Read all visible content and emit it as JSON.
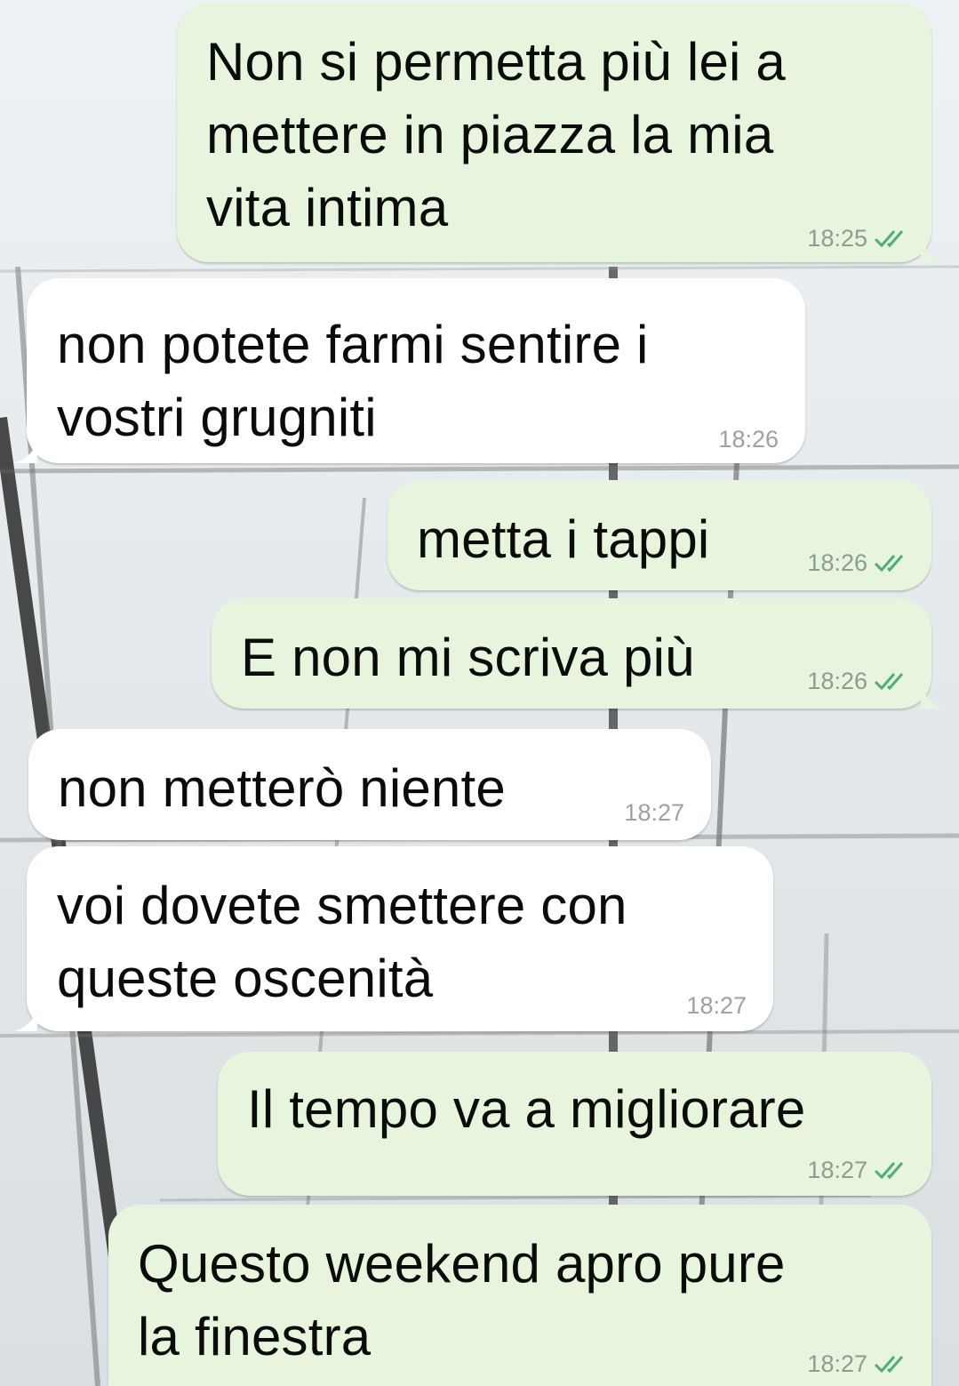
{
  "colors": {
    "outgoing_bubble": "#e6f5dc",
    "incoming_bubble": "#ffffff",
    "timestamp": "#8d9c95",
    "read_ticks": "#4caf78"
  },
  "messages": [
    {
      "direction": "outgoing",
      "text": "Non si permetta più lei a\nmettere in piazza la mia\nvita intima",
      "time": "18:25",
      "status_icon": "double-check-icon"
    },
    {
      "direction": "incoming",
      "text": "non potete farmi sentire i\nvostri grugniti",
      "time": "18:26"
    },
    {
      "direction": "outgoing",
      "text": "metta i tappi",
      "time": "18:26",
      "status_icon": "double-check-icon"
    },
    {
      "direction": "outgoing",
      "text": "E non mi scriva più",
      "time": "18:26",
      "status_icon": "double-check-icon"
    },
    {
      "direction": "incoming",
      "text": "non metterò niente",
      "time": "18:27"
    },
    {
      "direction": "incoming",
      "text": "voi dovete smettere con\nqueste oscenità",
      "time": "18:27"
    },
    {
      "direction": "outgoing",
      "text": "Il tempo va a migliorare",
      "time": "18:27",
      "status_icon": "double-check-icon"
    },
    {
      "direction": "outgoing",
      "text": "Questo weekend apro pure\nla finestra",
      "time": "18:27",
      "status_icon": "double-check-icon"
    }
  ]
}
